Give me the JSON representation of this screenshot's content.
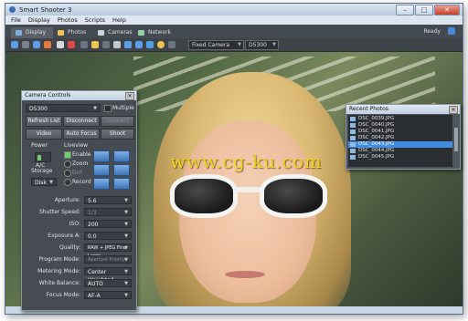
{
  "window": {
    "title": "Smart Shooter 3",
    "controls": {
      "min": "–",
      "max": "□",
      "close": "✕"
    }
  },
  "menu": [
    "File",
    "Display",
    "Photos",
    "Scripts",
    "Help"
  ],
  "tabs": [
    {
      "label": "Display",
      "icon": "display-icon"
    },
    {
      "label": "Photos",
      "icon": "photos-icon"
    },
    {
      "label": "Cameras",
      "icon": "cameras-icon"
    },
    {
      "label": "Network",
      "icon": "network-icon"
    }
  ],
  "status": {
    "ready": "Ready"
  },
  "toolbar": {
    "camera_mode": "Fixed Camera",
    "camera_model": "D5300"
  },
  "watermark": "www.cg-ku.com",
  "camera_controls": {
    "title": "Camera Controls",
    "camera": "D5300",
    "multiple": "Multiple",
    "buttons": {
      "refresh": "Refresh List",
      "disconnect": "Disconnect",
      "connect": "Connect",
      "video": "Video",
      "autofocus": "Auto Focus",
      "shoot": "Shoot"
    },
    "power": {
      "label": "Power",
      "value": "A/C"
    },
    "storage": {
      "label": "Storage",
      "value": "Disk"
    },
    "liveview": {
      "label": "Liveview",
      "enable": "Enable",
      "zoom": "Zoom",
      "dof": "DoF",
      "record": "Record"
    },
    "settings": [
      {
        "label": "Aperture:",
        "value": "5.6",
        "enabled": true
      },
      {
        "label": "Shutter Speed:",
        "value": "1/3",
        "enabled": false
      },
      {
        "label": "ISO:",
        "value": "200",
        "enabled": true
      },
      {
        "label": "Exposure A:",
        "value": "0.0",
        "enabled": true
      },
      {
        "label": "Quality:",
        "value": "RAW + JPEG Fine Large",
        "enabled": true
      },
      {
        "label": "Program Mode:",
        "value": "Aperture Priority",
        "enabled": false
      },
      {
        "label": "Metering Mode:",
        "value": "Center Weighted",
        "enabled": true
      },
      {
        "label": "White Balance:",
        "value": "AUTO",
        "enabled": true
      },
      {
        "label": "Focus Mode:",
        "value": "AF-A",
        "enabled": true
      }
    ]
  },
  "recent_photos": {
    "title": "Recent Photos",
    "items": [
      "DSC_0039.JPG",
      "DSC_0040.JPG",
      "DSC_0041.JPG",
      "DSC_0042.JPG",
      "DSC_0043.JPG",
      "DSC_0044.JPG",
      "DSC_0045.JPG"
    ],
    "selected_index": 4
  },
  "colors": {
    "accent": "#3e8de0",
    "panel": "#474c53",
    "watermark": "#f2d21b"
  }
}
